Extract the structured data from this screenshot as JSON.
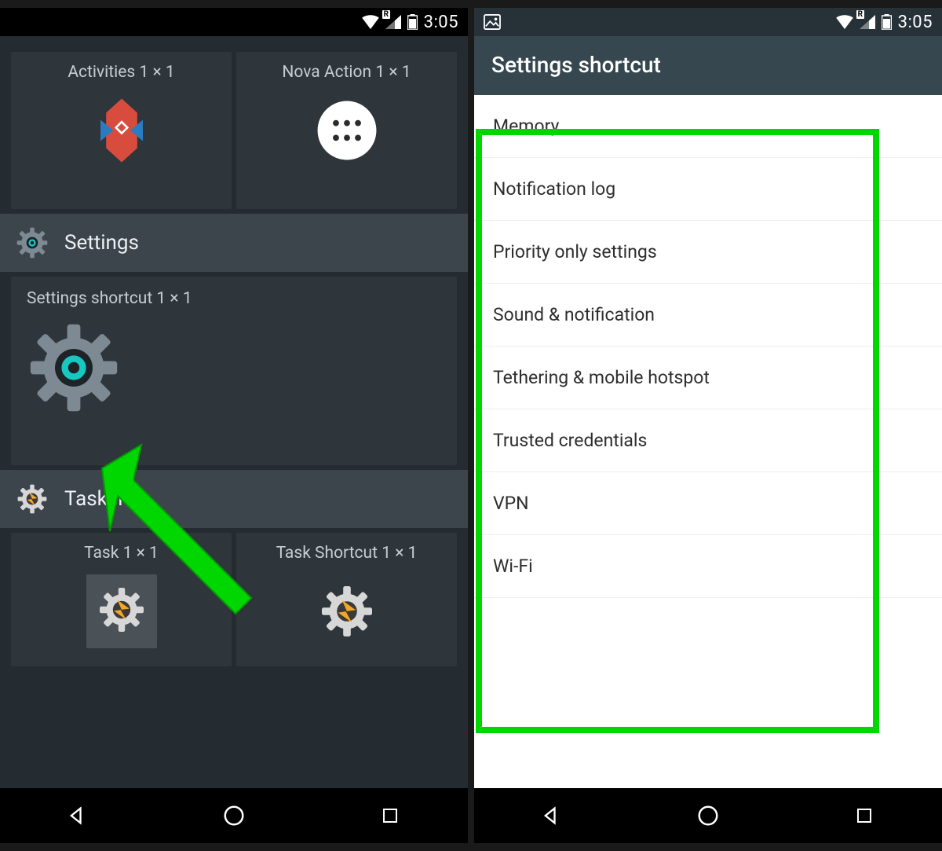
{
  "status": {
    "time": "3:05",
    "signal_label": "R"
  },
  "left": {
    "widgets_top": [
      {
        "label": "Activities  1 × 1",
        "icon": "nova-activities"
      },
      {
        "label": "Nova Action  1 × 1",
        "icon": "nova-action"
      }
    ],
    "section_settings": "Settings",
    "settings_shortcut_label": "Settings shortcut  1 × 1",
    "section_tasker": "Tasker",
    "widgets_bottom": [
      {
        "label": "Task  1 × 1",
        "icon": "tasker"
      },
      {
        "label": "Task Shortcut  1 × 1",
        "icon": "tasker"
      }
    ]
  },
  "right": {
    "title": "Settings shortcut",
    "items": [
      "Memory",
      "Notification log",
      "Priority only settings",
      "Sound & notification",
      "Tethering & mobile hotspot",
      "Trusted credentials",
      "VPN",
      "Wi-Fi"
    ]
  }
}
